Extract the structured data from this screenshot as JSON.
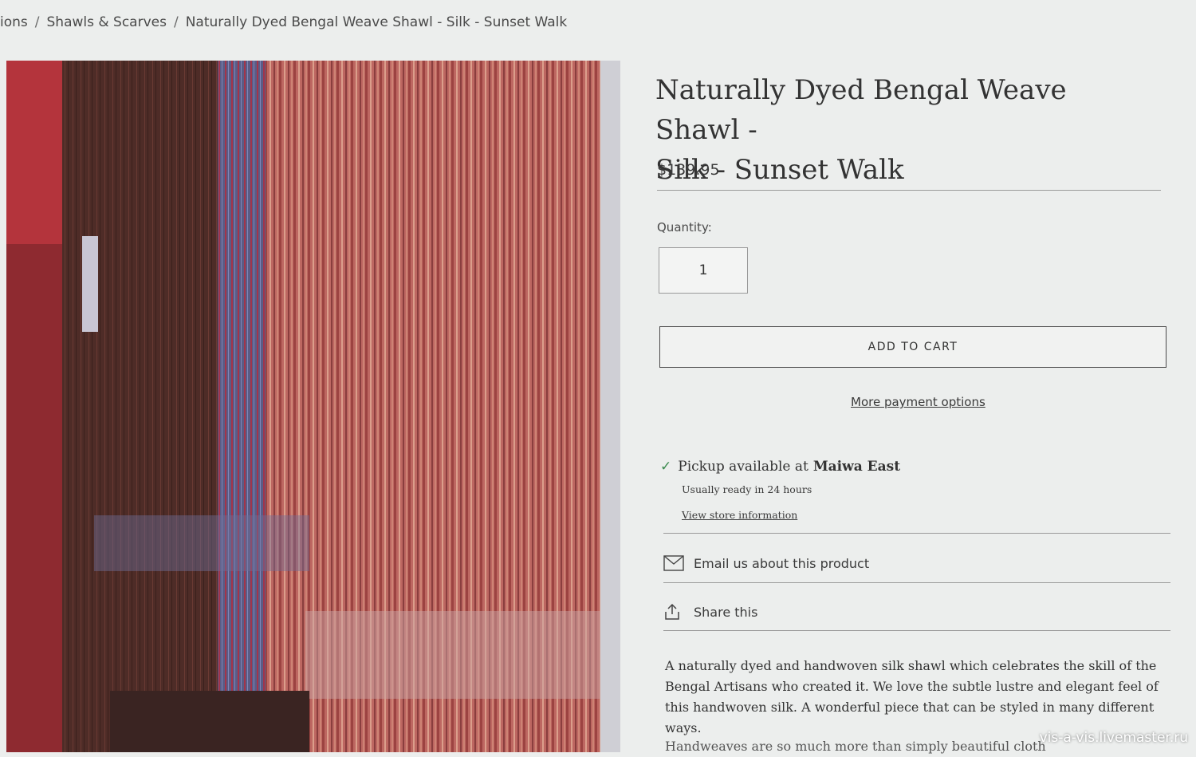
{
  "breadcrumb": {
    "items": [
      "ions",
      "Shawls & Scarves",
      "Naturally Dyed Bengal Weave Shawl - Silk - Sunset Walk"
    ],
    "separator": "/"
  },
  "product": {
    "title_line1": "Naturally Dyed Bengal Weave Shawl -",
    "title_line2": "Silk - Sunset Walk",
    "price": "$139.95",
    "quantity_label": "Quantity:",
    "quantity_value": "1",
    "add_to_cart": "ADD TO CART",
    "more_payment": "More payment options"
  },
  "pickup": {
    "prefix": "Pickup available at",
    "store": "Maiwa East",
    "ready": "Usually ready in 24 hours",
    "view_store": "View store information"
  },
  "actions": {
    "email": "Email us about this product",
    "share": "Share this"
  },
  "description": {
    "text": "A naturally dyed and handwoven silk shawl which celebrates the skill of the Bengal Artisans who created it. We love the subtle lustre and elegant feel of this handwoven silk. A wonderful piece that can be styled in many different ways.",
    "partial": "Handweaves are so much more than simply beautiful cloth"
  },
  "watermark": "vis-a-vis.livemaster.ru",
  "icons": {
    "check": "check-icon",
    "email": "envelope-icon",
    "share": "share-icon"
  },
  "colors": {
    "page_bg": "#eceeed",
    "text": "#333333",
    "check": "#3b8a4e",
    "shawl_red": "#a2323a",
    "shawl_brown": "#4b2a26"
  }
}
